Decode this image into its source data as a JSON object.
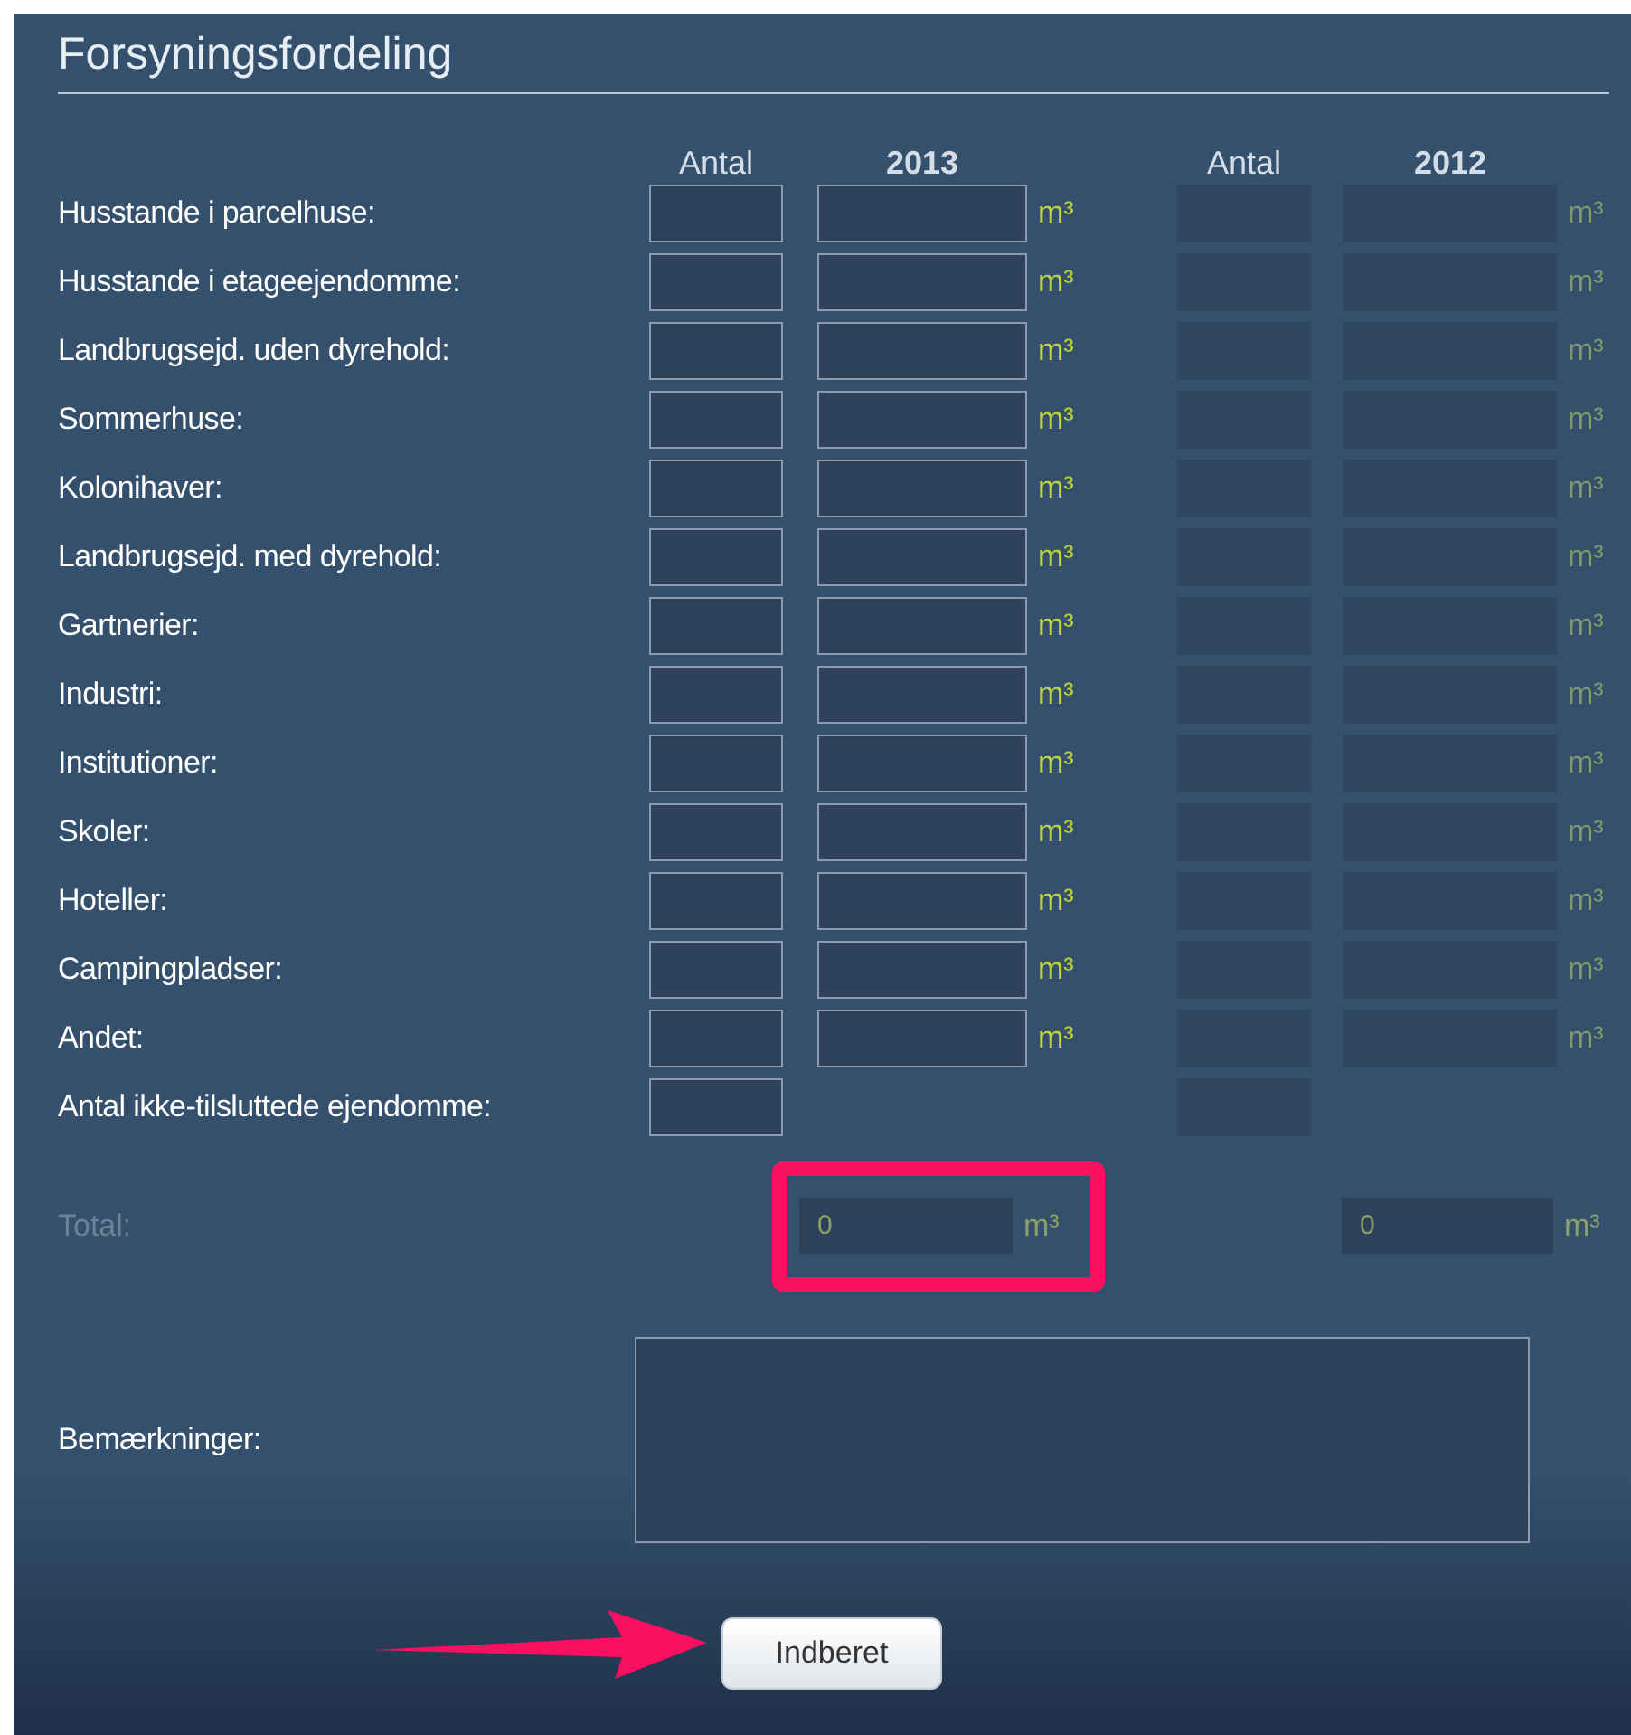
{
  "section": {
    "title": "Forsyningsfordeling"
  },
  "header": {
    "current_count": "Antal",
    "current_year": "2013",
    "previous_count": "Antal",
    "previous_year": "2012",
    "previous_disabled": true
  },
  "rows": [
    {
      "label": "Husstande i parcelhuse:",
      "kind": "volume",
      "unit": "m³",
      "previous_unit": "m³"
    },
    {
      "label": "Husstande i etageejendomme:",
      "kind": "volume",
      "unit": "m³",
      "previous_unit": "m³"
    },
    {
      "label": "Landbrugsejd. uden dyrehold:",
      "kind": "volume",
      "unit": "m³",
      "previous_unit": "m³"
    },
    {
      "label": "Sommerhuse:",
      "kind": "volume",
      "unit": "m³",
      "previous_unit": "m³"
    },
    {
      "label": "Kolonihaver:",
      "kind": "volume",
      "unit": "m³",
      "previous_unit": "m³"
    },
    {
      "label": "Landbrugsejd. med dyrehold:",
      "kind": "volume",
      "unit": "m³",
      "previous_unit": "m³"
    },
    {
      "label": "Gartnerier:",
      "kind": "volume",
      "unit": "m³",
      "previous_unit": "m³"
    },
    {
      "label": "Industri:",
      "kind": "volume",
      "unit": "m³",
      "previous_unit": "m³"
    },
    {
      "label": "Institutioner:",
      "kind": "volume",
      "unit": "m³",
      "previous_unit": "m³"
    },
    {
      "label": "Skoler:",
      "kind": "volume",
      "unit": "m³",
      "previous_unit": "m³"
    },
    {
      "label": "Hoteller:",
      "kind": "volume",
      "unit": "m³",
      "previous_unit": "m³"
    },
    {
      "label": "Campingpladser:",
      "kind": "volume",
      "unit": "m³",
      "previous_unit": "m³"
    },
    {
      "label": "Andet:",
      "kind": "volume",
      "unit": "m³",
      "previous_unit": "m³"
    },
    {
      "label": "Antal ikke-tilsluttede ejendomme:",
      "kind": "count"
    }
  ],
  "total": {
    "label": "Total:",
    "disabled": true,
    "value": "0",
    "unit": "m³",
    "previous_value": "0",
    "previous_unit": "m³",
    "highlighted": true
  },
  "remarks": {
    "label": "Bemærkninger:"
  },
  "submit": {
    "label": "Indberet"
  }
}
